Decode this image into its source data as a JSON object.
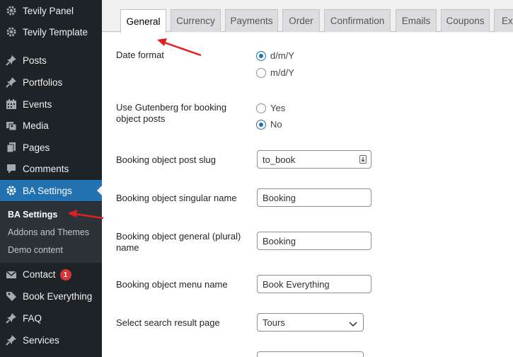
{
  "sidebar": {
    "items": [
      {
        "label": "Tevily Panel",
        "icon": "gear-icon"
      },
      {
        "label": "Tevily Template",
        "icon": "gear-icon"
      },
      {
        "label": "Posts",
        "icon": "pin-icon"
      },
      {
        "label": "Portfolios",
        "icon": "pin-icon"
      },
      {
        "label": "Events",
        "icon": "calendar-icon"
      },
      {
        "label": "Media",
        "icon": "media-icon"
      },
      {
        "label": "Pages",
        "icon": "page-icon"
      },
      {
        "label": "Comments",
        "icon": "comment-icon"
      },
      {
        "label": "BA Settings",
        "icon": "gear-icon"
      },
      {
        "label": "Contact",
        "icon": "mail-icon",
        "badge": "1"
      },
      {
        "label": "Book Everything",
        "icon": "tag-icon"
      },
      {
        "label": "FAQ",
        "icon": "pin-icon"
      },
      {
        "label": "Services",
        "icon": "pin-icon"
      }
    ],
    "submenu": [
      {
        "label": "BA Settings"
      },
      {
        "label": "Addons and Themes"
      },
      {
        "label": "Demo content"
      }
    ]
  },
  "tabs": [
    "General",
    "Currency",
    "Payments",
    "Order",
    "Confirmation",
    "Emails",
    "Coupons",
    "Exp"
  ],
  "form": {
    "date_format": {
      "label": "Date format",
      "options": [
        "d/m/Y",
        "m/d/Y"
      ],
      "selected": "d/m/Y"
    },
    "gutenberg": {
      "label_line1": "Use Gutenberg for booking",
      "label_line2": "object posts",
      "options": [
        "Yes",
        "No"
      ],
      "selected": "No"
    },
    "post_slug": {
      "label": "Booking object post slug",
      "value": "to_book"
    },
    "singular_name": {
      "label": "Booking object singular name",
      "value": "Booking"
    },
    "plural_name": {
      "label_line1": "Booking object general (plural)",
      "label_line2": "name",
      "value": "Booking"
    },
    "menu_name": {
      "label": "Booking object menu name",
      "value": "Book Everything"
    },
    "search_page": {
      "label": "Select search result page",
      "value": "Tours"
    }
  },
  "colors": {
    "sidebar_bg": "#1d2327",
    "accent": "#2271b1",
    "annotation_arrow": "#e02020"
  }
}
